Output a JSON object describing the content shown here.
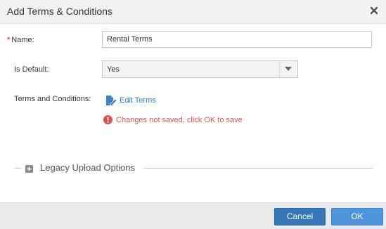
{
  "dialog": {
    "title": "Add Terms & Conditions",
    "close_icon": "close-icon"
  },
  "form": {
    "name": {
      "required_mark": "*",
      "label": "Name:",
      "value": "Rental Terms"
    },
    "is_default": {
      "label": "Is Default:",
      "selected": "Yes",
      "icon": "chevron-down-icon"
    },
    "terms": {
      "label": "Terms and Conditions:",
      "edit_label": "Edit Terms",
      "edit_icon": "edit-document-icon",
      "warning_icon": "error-circle-icon",
      "warning_text": "Changes not saved, click OK to save"
    }
  },
  "legacy": {
    "label": "Legacy Upload Options",
    "toggle_icon": "plus-square-icon",
    "expanded": false
  },
  "footer": {
    "cancel_label": "Cancel",
    "ok_label": "OK"
  },
  "colors": {
    "primary": "#3578b8",
    "primary_light": "#4d96dc",
    "link": "#2e7ec4",
    "error": "#d9534f",
    "titlebar_bg": "#f2f2f2",
    "footer_bg": "#eaeaea"
  }
}
